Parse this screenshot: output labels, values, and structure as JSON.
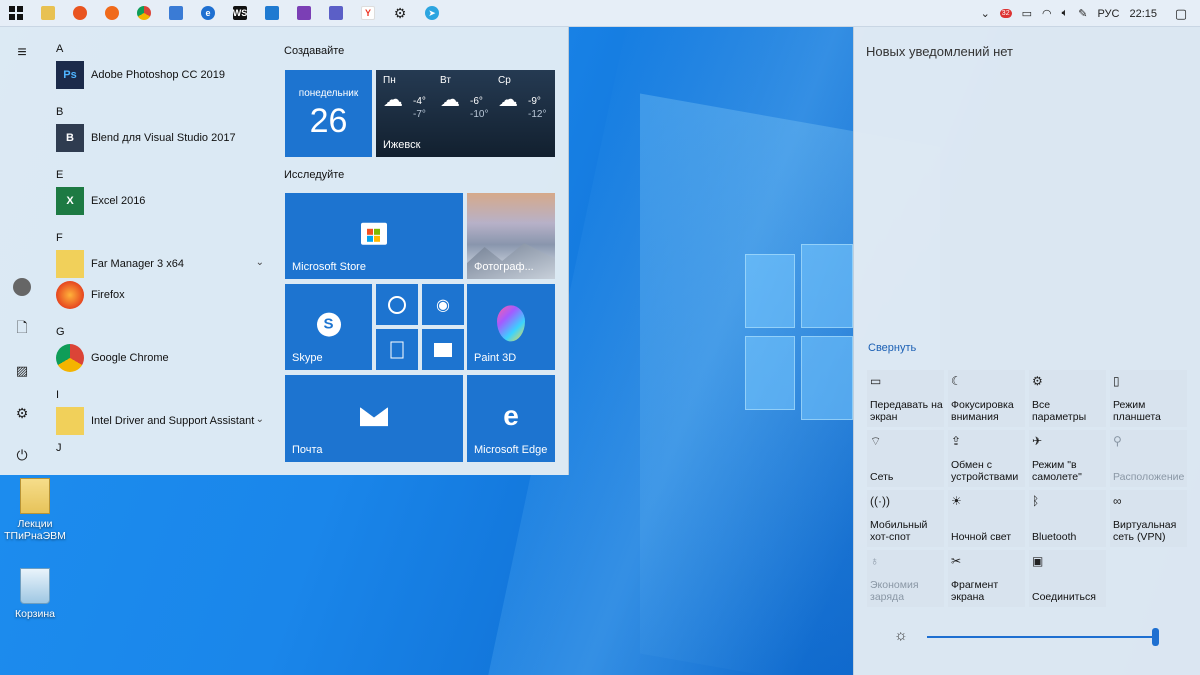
{
  "colors": {
    "tile_blue": "#1d74d0",
    "accent": "#1e6fd1",
    "taskbar_bg": "#e6eef7"
  },
  "taskbar": {
    "pinned": [
      {
        "name": "start",
        "icon": "windows-logo-icon"
      },
      {
        "name": "explorer",
        "icon": "folder-icon"
      },
      {
        "name": "ubuntu",
        "icon": "ubuntu-icon"
      },
      {
        "name": "firefox",
        "icon": "firefox-icon"
      },
      {
        "name": "chrome",
        "icon": "chrome-icon"
      },
      {
        "name": "app",
        "icon": "paper-plane-app-icon"
      },
      {
        "name": "edge",
        "icon": "edge-icon"
      },
      {
        "name": "webstorm",
        "icon": "webstorm-icon",
        "text": "WS"
      },
      {
        "name": "vscode",
        "icon": "vscode-icon"
      },
      {
        "name": "visual-studio",
        "icon": "visual-studio-icon"
      },
      {
        "name": "teams",
        "icon": "teams-icon"
      },
      {
        "name": "yandex",
        "icon": "yandex-icon",
        "text": "Y"
      },
      {
        "name": "settings",
        "icon": "gear-icon"
      },
      {
        "name": "telegram",
        "icon": "telegram-icon"
      }
    ],
    "tray": {
      "badge_count": "32",
      "language": "РУС",
      "time": "22:15"
    }
  },
  "start_menu": {
    "apps": [
      {
        "letter": "A"
      },
      {
        "label": "Adobe Photoshop CC 2019",
        "icon_text": "Ps",
        "color": "#1b2a4a"
      },
      {
        "letter": "B"
      },
      {
        "label": "Blend для Visual Studio 2017",
        "icon_text": "B",
        "color": "#2f3c50"
      },
      {
        "letter": "E"
      },
      {
        "label": "Excel 2016",
        "icon_text": "X",
        "color": "#1d7a43"
      },
      {
        "letter": "F"
      },
      {
        "label": "Far Manager 3 x64",
        "icon_text": "",
        "color": "#f1d05a",
        "expand": true
      },
      {
        "label": "Firefox",
        "icon_text": "",
        "color": "#e66b1f"
      },
      {
        "letter": "G"
      },
      {
        "label": "Google Chrome",
        "icon_text": "",
        "color": "#4a8f3c"
      },
      {
        "letter": "I"
      },
      {
        "label": "Intel Driver and Support Assistant",
        "icon_text": "",
        "color": "#f1d05a",
        "expand": true
      },
      {
        "letter": "J"
      }
    ],
    "group_create": "Создавайте",
    "group_explore": "Исследуйте",
    "calendar": {
      "day_name": "понедельник",
      "day": "26"
    },
    "weather": {
      "city": "Ижевск",
      "days": [
        {
          "name": "Пн",
          "high": "-4°",
          "low": "-7°"
        },
        {
          "name": "Вт",
          "high": "-6°",
          "low": "-10°"
        },
        {
          "name": "Ср",
          "high": "-9°",
          "low": "-12°"
        }
      ]
    },
    "tiles": {
      "store": "Microsoft Store",
      "photos": "Фотограф...",
      "skype": "Skype",
      "paint3d": "Paint 3D",
      "mail": "Почта",
      "edge": "Microsoft Edge"
    }
  },
  "action_center": {
    "title": "Новых уведомлений нет",
    "collapse": "Свернуть",
    "quick_actions": [
      {
        "label": "Передавать на экран",
        "icon": "project-icon",
        "disabled": false
      },
      {
        "label": "Фокусировка внимания",
        "icon": "moon-icon",
        "disabled": false
      },
      {
        "label": "Все параметры",
        "icon": "gear-icon",
        "disabled": false
      },
      {
        "label": "Режим планшета",
        "icon": "tablet-icon",
        "disabled": false
      },
      {
        "label": "Сеть",
        "icon": "network-icon",
        "disabled": false
      },
      {
        "label": "Обмен с устройствами",
        "icon": "share-icon",
        "disabled": false
      },
      {
        "label": "Режим \"в самолете\"",
        "icon": "airplane-icon",
        "disabled": false
      },
      {
        "label": "Расположение",
        "icon": "location-icon",
        "disabled": true
      },
      {
        "label": "Мобильный хот-спот",
        "icon": "hotspot-icon",
        "disabled": false
      },
      {
        "label": "Ночной свет",
        "icon": "sun-icon",
        "disabled": false
      },
      {
        "label": "Bluetooth",
        "icon": "bluetooth-icon",
        "disabled": false
      },
      {
        "label": "Виртуальная сеть (VPN)",
        "icon": "vpn-icon",
        "disabled": false
      },
      {
        "label": "Экономия заряда",
        "icon": "battery-saver-icon",
        "disabled": true
      },
      {
        "label": "Фрагмент экрана",
        "icon": "snip-icon",
        "disabled": false
      },
      {
        "label": "Соединиться",
        "icon": "connect-icon",
        "disabled": false
      }
    ],
    "brightness": 1.0
  },
  "desktop": {
    "icons": [
      {
        "label": "Лекции ТПиРнаЭВМ",
        "icon": "folder-icon"
      },
      {
        "label": "Корзина",
        "icon": "recycle-bin-icon"
      }
    ]
  }
}
